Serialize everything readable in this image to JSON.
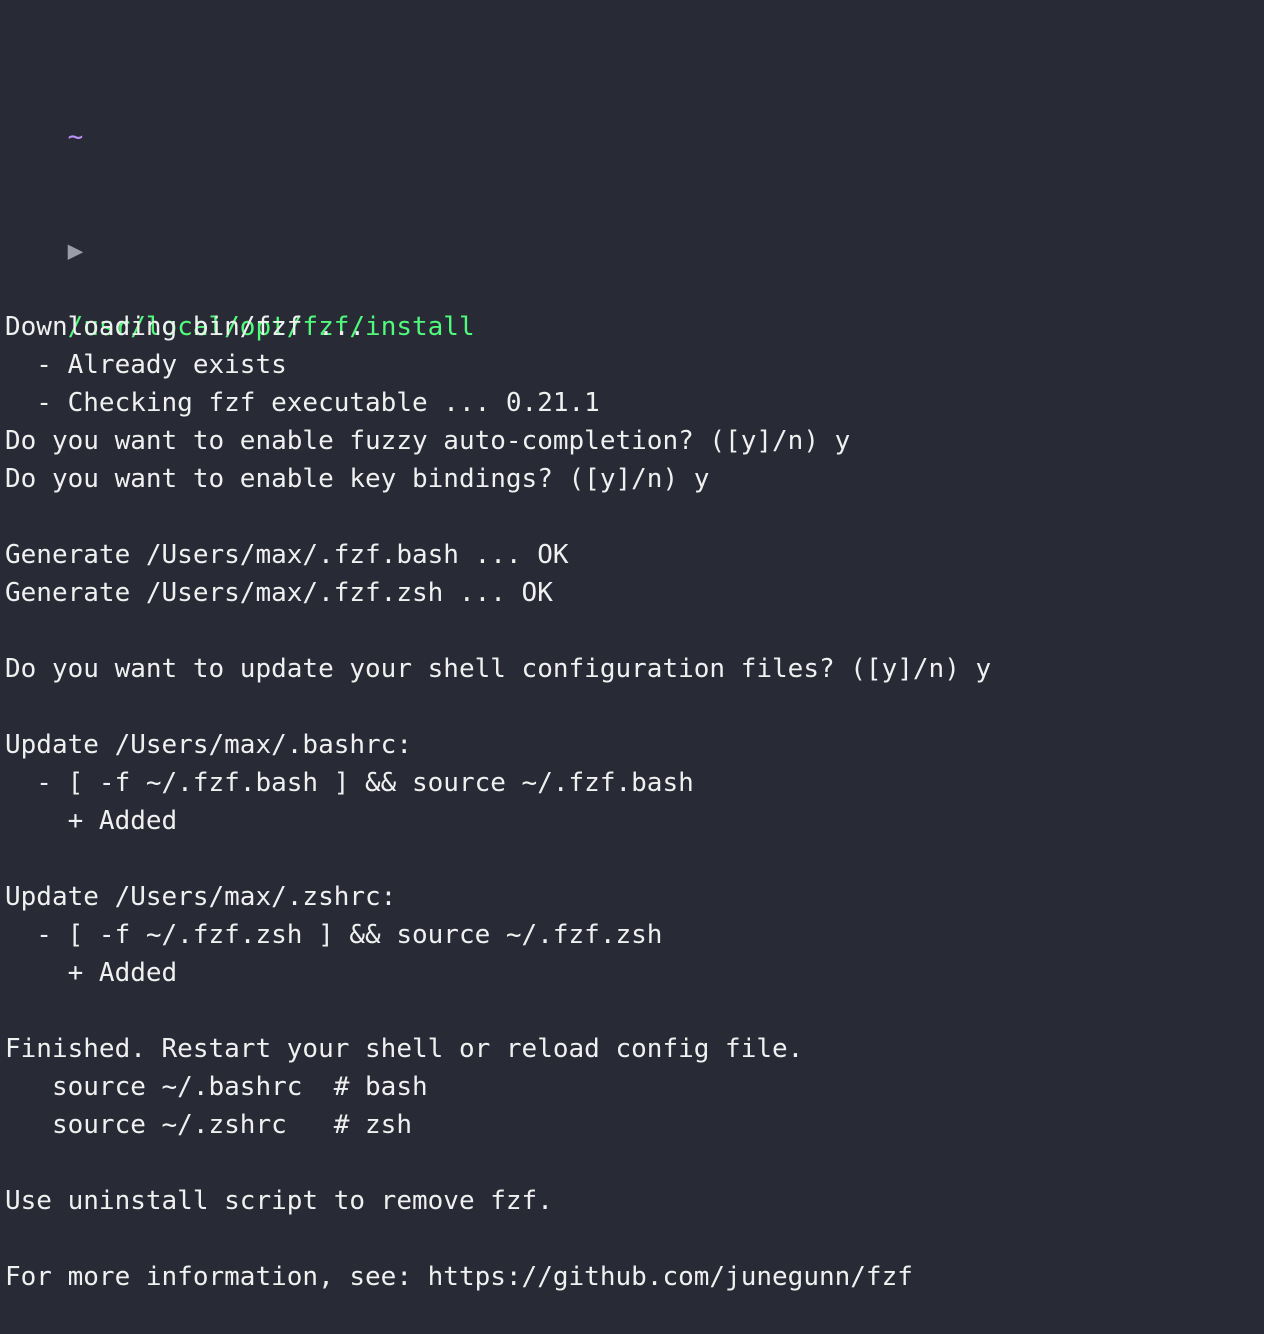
{
  "terminal": {
    "cwd_marker": "~",
    "prompt_symbol": "▶",
    "command": "/usr/local/opt/fzf/install",
    "output": [
      "Downloading bin/fzf ...",
      "  - Already exists",
      "  - Checking fzf executable ... 0.21.1",
      "Do you want to enable fuzzy auto-completion? ([y]/n) y",
      "Do you want to enable key bindings? ([y]/n) y",
      "",
      "Generate /Users/max/.fzf.bash ... OK",
      "Generate /Users/max/.fzf.zsh ... OK",
      "",
      "Do you want to update your shell configuration files? ([y]/n) y",
      "",
      "Update /Users/max/.bashrc:",
      "  - [ -f ~/.fzf.bash ] && source ~/.fzf.bash",
      "    + Added",
      "",
      "Update /Users/max/.zshrc:",
      "  - [ -f ~/.fzf.zsh ] && source ~/.fzf.zsh",
      "    + Added",
      "",
      "Finished. Restart your shell or reload config file.",
      "   source ~/.bashrc  # bash",
      "   source ~/.zshrc   # zsh",
      "",
      "Use uninstall script to remove fzf.",
      "",
      "For more information, see: https://github.com/junegunn/fzf"
    ]
  },
  "colors": {
    "background": "#282a36",
    "foreground": "#f0f0f0",
    "cwd": "#bd93f9",
    "command": "#50fa7b"
  }
}
